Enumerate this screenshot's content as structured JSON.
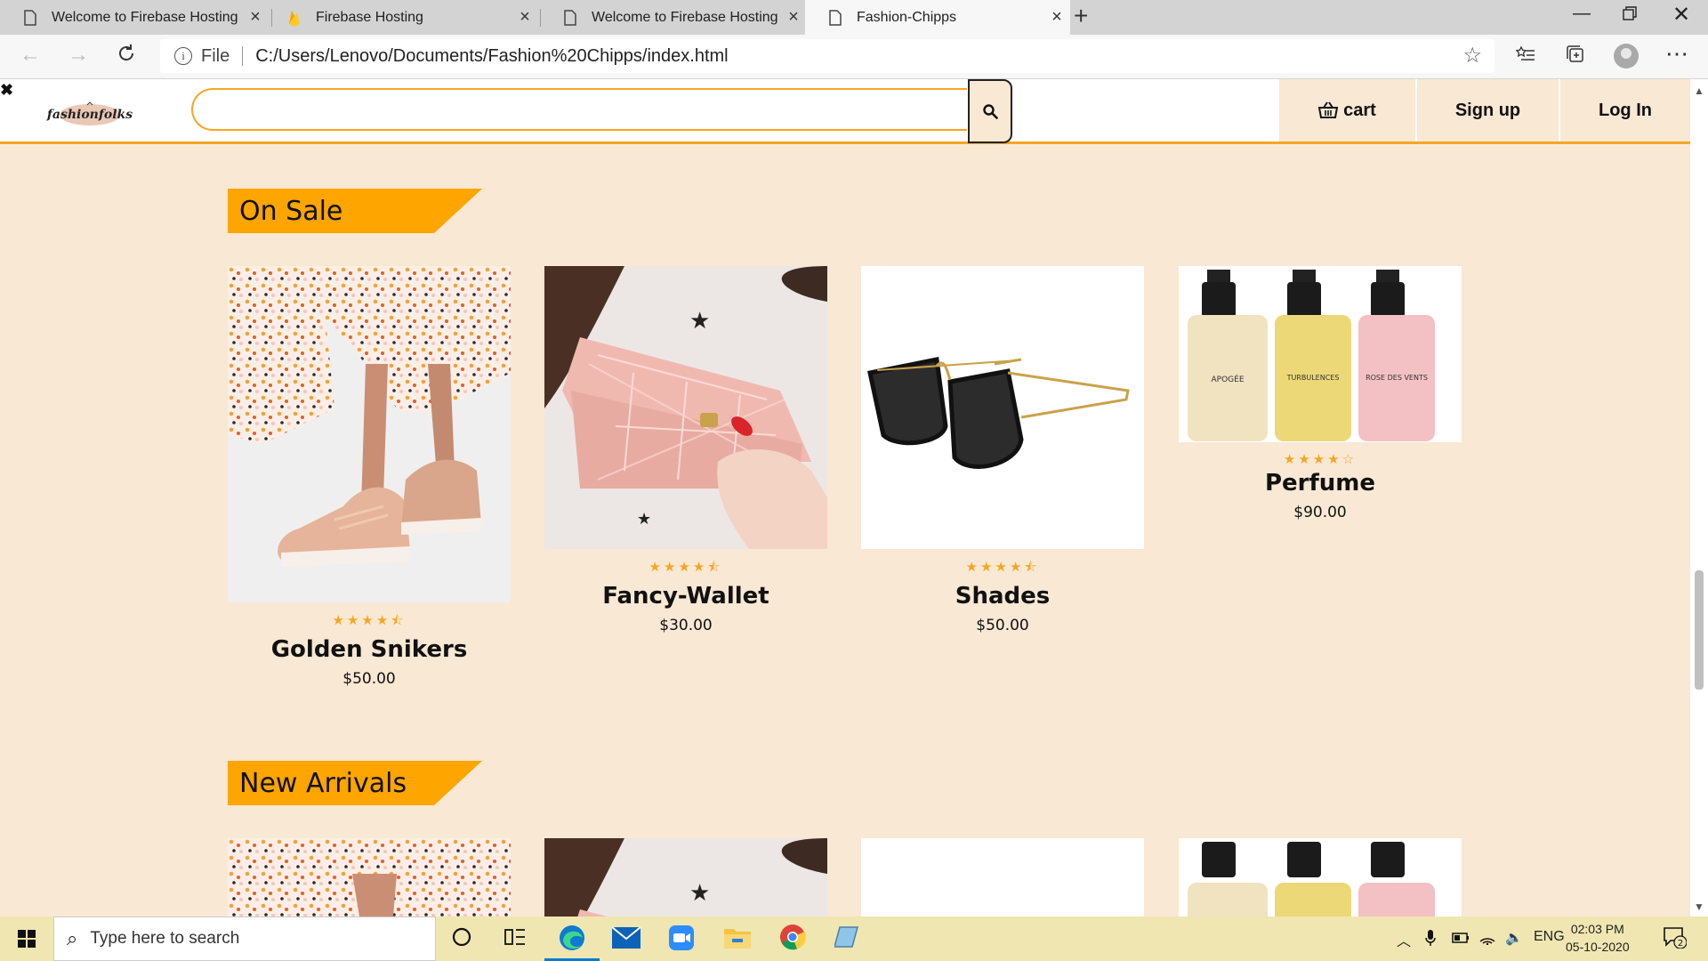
{
  "browser": {
    "tabs": [
      {
        "title": "Welcome to Firebase Hosting",
        "icon": "page-icon",
        "active": false
      },
      {
        "title": "Firebase Hosting",
        "icon": "firebase-icon",
        "active": false
      },
      {
        "title": "Welcome to Firebase Hosting",
        "icon": "page-icon",
        "active": false
      },
      {
        "title": "Fashion-Chipps",
        "icon": "page-icon",
        "active": true
      }
    ],
    "address": {
      "scheme_label": "File",
      "url": "C:/Users/Lenovo/Documents/Fashion%20Chipps/index.html"
    }
  },
  "site": {
    "logo_text": "fashionfolks",
    "search": {
      "placeholder": "",
      "value": ""
    },
    "nav": {
      "cart": "cart",
      "signup": "Sign up",
      "login": "Log In"
    },
    "sections": [
      {
        "title": "On Sale",
        "products": [
          {
            "name": "Golden Snikers",
            "price": "$50.00",
            "rating": 4.5
          },
          {
            "name": "Fancy-Wallet",
            "price": "$30.00",
            "rating": 4.5
          },
          {
            "name": "Shades",
            "price": "$50.00",
            "rating": 4.5
          },
          {
            "name": "Perfume",
            "price": "$90.00",
            "rating": 4
          },
          {
            "perfume_labels": [
              "APOGÉE",
              "TURBULENCES",
              "ROSE DES VENTS"
            ]
          }
        ]
      },
      {
        "title": "New Arrivals"
      }
    ]
  },
  "taskbar": {
    "search_placeholder": "Type here to search",
    "language": "ENG",
    "time": "02:03 PM",
    "date": "05-10-2020",
    "notification_count": "2"
  },
  "colors": {
    "accent": "#f5a623",
    "page_bg": "#f9e8d3",
    "banner": "#ffa500"
  }
}
